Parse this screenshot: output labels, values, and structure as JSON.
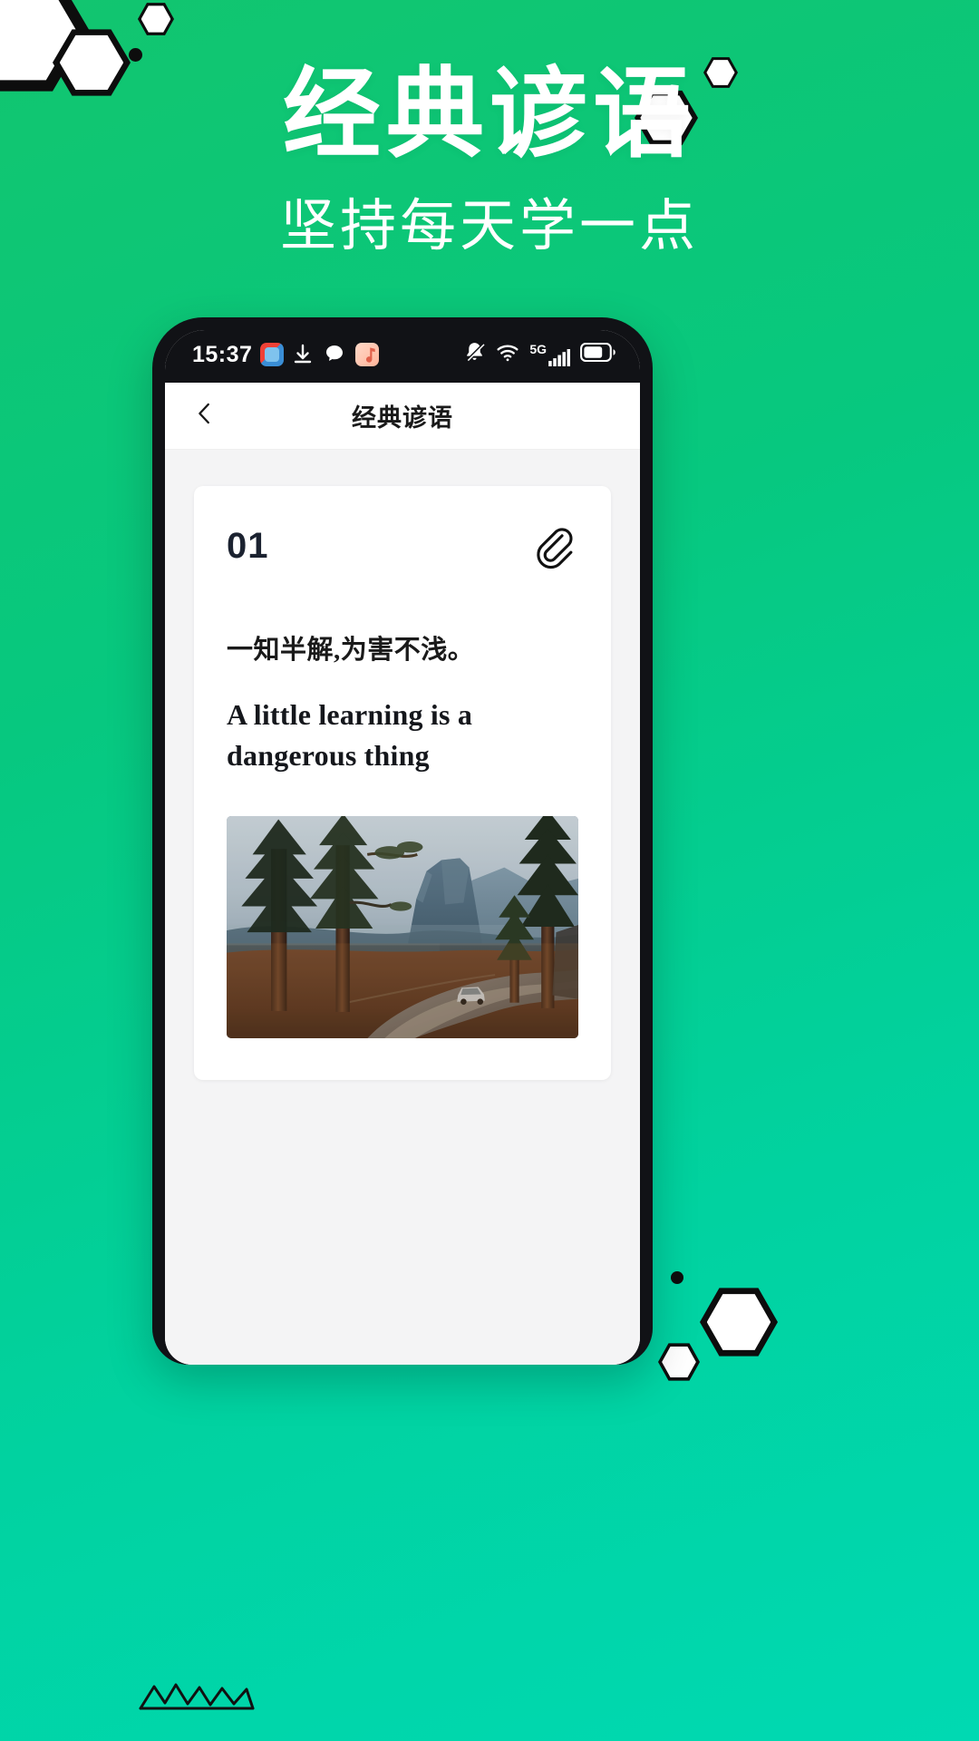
{
  "poster": {
    "title": "经典谚语",
    "subtitle": "坚持每天学一点",
    "bg_color_start": "#12c56f",
    "bg_color_end": "#00d9b2",
    "decor_shape": "hexagon"
  },
  "phone": {
    "statusbar": {
      "time": "15:37",
      "left_icons": [
        "news-app-icon",
        "download-icon",
        "message-icon",
        "music-icon"
      ],
      "right_icons": [
        "bell-muted-icon",
        "wifi-icon",
        "signal-5g-icon",
        "battery-icon"
      ],
      "network_label": "5G",
      "background": "#111216"
    },
    "navbar": {
      "back_label": "‹",
      "title": "经典谚语"
    },
    "content": {
      "background": "#f4f4f5",
      "card": {
        "number": "01",
        "attach_icon": "paperclip-icon",
        "chinese": "一知半解,为害不浅。",
        "english": "A little learning is a dangerous thing",
        "image_alt": "mountain-road-landscape"
      }
    }
  }
}
